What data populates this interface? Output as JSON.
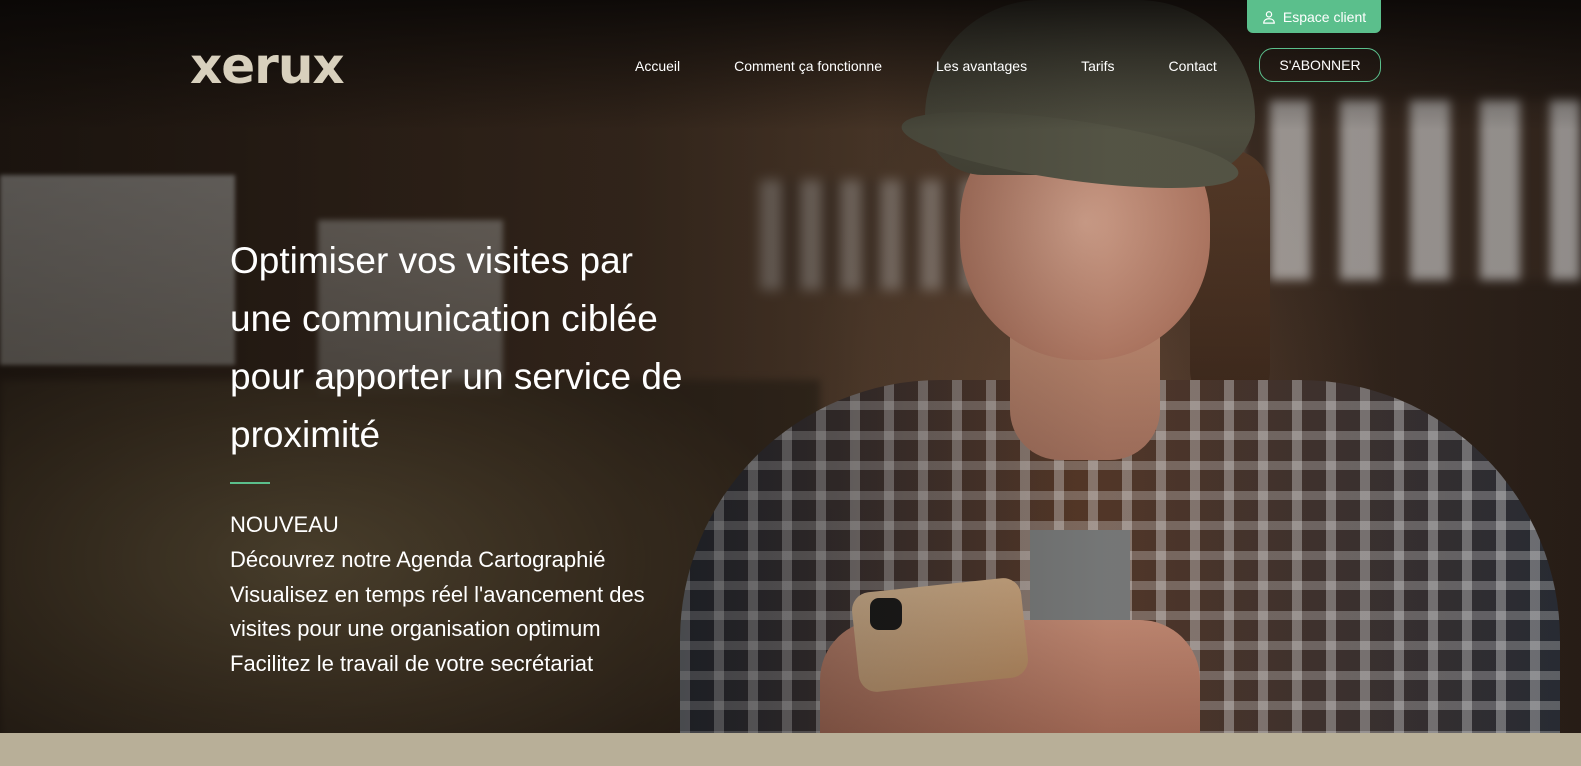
{
  "header": {
    "logo_text": "xerux",
    "espace_client": "Espace client",
    "nav": [
      "Accueil",
      "Comment ça fonctionne",
      "Les avantages",
      "Tarifs",
      "Contact"
    ],
    "subscribe": "S'ABONNER"
  },
  "hero": {
    "headline_lines": [
      "Optimiser vos visites par",
      "une communication ciblée",
      "pour apporter un service de",
      "proximité"
    ],
    "badge": "NOUVEAU",
    "lines": [
      "Découvrez notre Agenda Cartographié",
      "Visualisez en temps réel l'avancement des",
      "visites pour une organisation optimum",
      "Facilitez le travail de votre secrétariat"
    ]
  },
  "colors": {
    "accent": "#5bbf8c",
    "footer_band": "#b8af98"
  },
  "icons": {
    "espace_client_icon": "user-icon"
  }
}
